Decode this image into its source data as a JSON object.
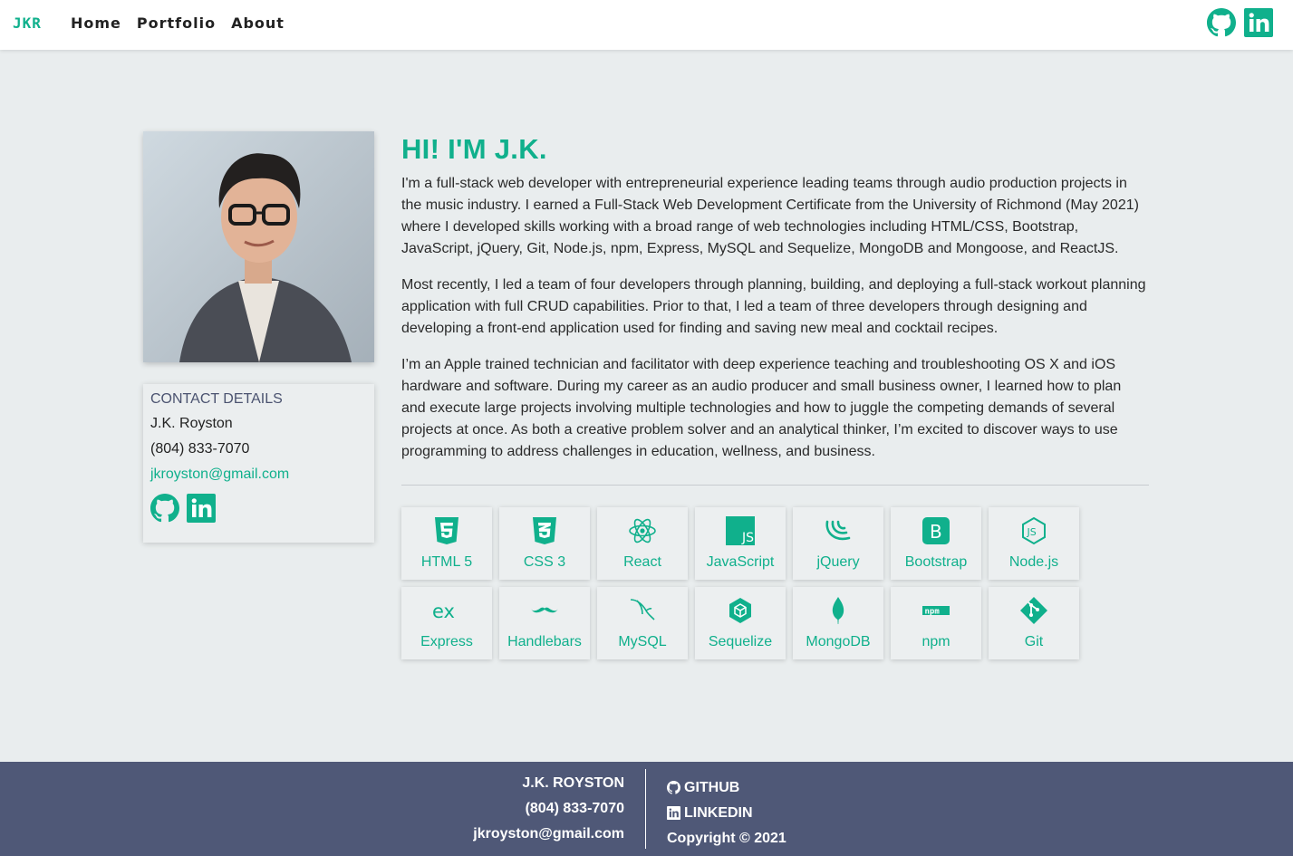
{
  "navbar": {
    "brand": "JKR",
    "links": [
      "Home",
      "Portfolio",
      "About"
    ],
    "icons": [
      "github-icon",
      "linkedin-icon"
    ]
  },
  "profile": {
    "photo_alt": "J.K. Royston",
    "contact_title": "CONTACT DETAILS",
    "name": "J.K. Royston",
    "phone": "(804) 833-7070",
    "email": "jkroyston@gmail.com",
    "icons": [
      "github-icon",
      "linkedin-icon"
    ]
  },
  "main": {
    "heading": "HI! I'M J.K.",
    "paragraphs": [
      "I'm a full-stack web developer with entrepreneurial experience leading teams through audio production projects in the music industry. I earned a Full-Stack Web Development Certificate from the University of Richmond (May 2021) where I developed skills working with a broad range of web technologies including HTML/CSS, Bootstrap, JavaScript, jQuery, Git, Node.js, npm, Express, MySQL and Sequelize, MongoDB and Mongoose, and ReactJS.",
      "Most recently, I led a team of four developers through planning, building, and deploying a full-stack workout planning application with full CRUD capabilities. Prior to that, I led a team of three developers through designing and developing a front-end application used for finding and saving new meal and cocktail recipes.",
      "I’m an Apple trained technician and facilitator with deep experience teaching and troubleshooting OS X and iOS hardware and software. During my career as an audio producer and small business owner, I learned how to plan and execute large projects involving multiple technologies and how to juggle the competing demands of several projects at once. As both a creative problem solver and an analytical thinker, I’m excited to discover ways to use programming to address challenges in education, wellness, and business."
    ]
  },
  "skills": [
    {
      "label": "HTML 5",
      "icon": "html5-icon"
    },
    {
      "label": "CSS 3",
      "icon": "css3-icon"
    },
    {
      "label": "React",
      "icon": "react-icon"
    },
    {
      "label": "JavaScript",
      "icon": "javascript-icon"
    },
    {
      "label": "jQuery",
      "icon": "jquery-icon"
    },
    {
      "label": "Bootstrap",
      "icon": "bootstrap-icon"
    },
    {
      "label": "Node.js",
      "icon": "nodejs-icon"
    },
    {
      "label": "Express",
      "icon": "express-icon"
    },
    {
      "label": "Handlebars",
      "icon": "handlebars-icon"
    },
    {
      "label": "MySQL",
      "icon": "mysql-icon"
    },
    {
      "label": "Sequelize",
      "icon": "sequelize-icon"
    },
    {
      "label": "MongoDB",
      "icon": "mongodb-icon"
    },
    {
      "label": "npm",
      "icon": "npm-icon"
    },
    {
      "label": "Git",
      "icon": "git-icon"
    }
  ],
  "footer": {
    "name": "J.K. ROYSTON",
    "phone": "(804) 833-7070",
    "email": "jkroyston@gmail.com",
    "github": "GITHUB",
    "linkedin": "LINKEDIN",
    "copyright": "Copyright © 2021"
  },
  "colors": {
    "accent": "#10b08c",
    "footer_bg": "#4f5877",
    "page_bg": "#e9edee"
  }
}
